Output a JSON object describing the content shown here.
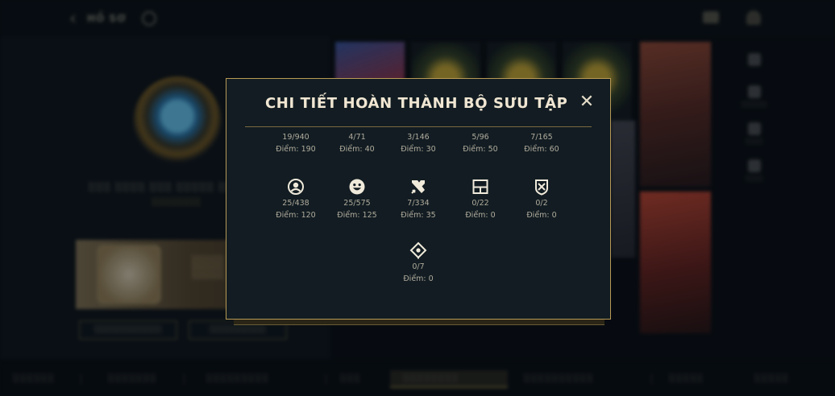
{
  "header": {
    "back_label": "HỒ SƠ"
  },
  "modal": {
    "title": "CHI TIẾT HOÀN THÀNH BỘ SƯU TẬP",
    "close_symbol": "✕",
    "items": [
      {
        "icon": "partial-icon",
        "count": "19/940",
        "points": "Điểm: 190"
      },
      {
        "icon": "partial-icon",
        "count": "4/71",
        "points": "Điểm: 40"
      },
      {
        "icon": "partial-icon",
        "count": "3/146",
        "points": "Điểm: 30"
      },
      {
        "icon": "partial-icon",
        "count": "5/96",
        "points": "Điểm: 50"
      },
      {
        "icon": "partial-icon",
        "count": "7/165",
        "points": "Điểm: 60"
      },
      {
        "icon": "profile-icon",
        "count": "25/438",
        "points": "Điểm: 120"
      },
      {
        "icon": "emote-icon",
        "count": "25/575",
        "points": "Điểm: 125"
      },
      {
        "icon": "crossed-swords-icon",
        "count": "7/334",
        "points": "Điểm: 35"
      },
      {
        "icon": "window-frame-icon",
        "count": "0/22",
        "points": "Điểm: 0"
      },
      {
        "icon": "shield-badge-icon",
        "count": "0/2",
        "points": "Điểm: 0"
      },
      {
        "icon": "diamond-ward-icon",
        "count": "0/7",
        "points": "Điểm: 0"
      }
    ]
  },
  "colors": {
    "gold_border": "#b89a55",
    "modal_bg": "#121c22",
    "title_text": "#f0e6d2",
    "item_text": "#b1ac9d"
  }
}
